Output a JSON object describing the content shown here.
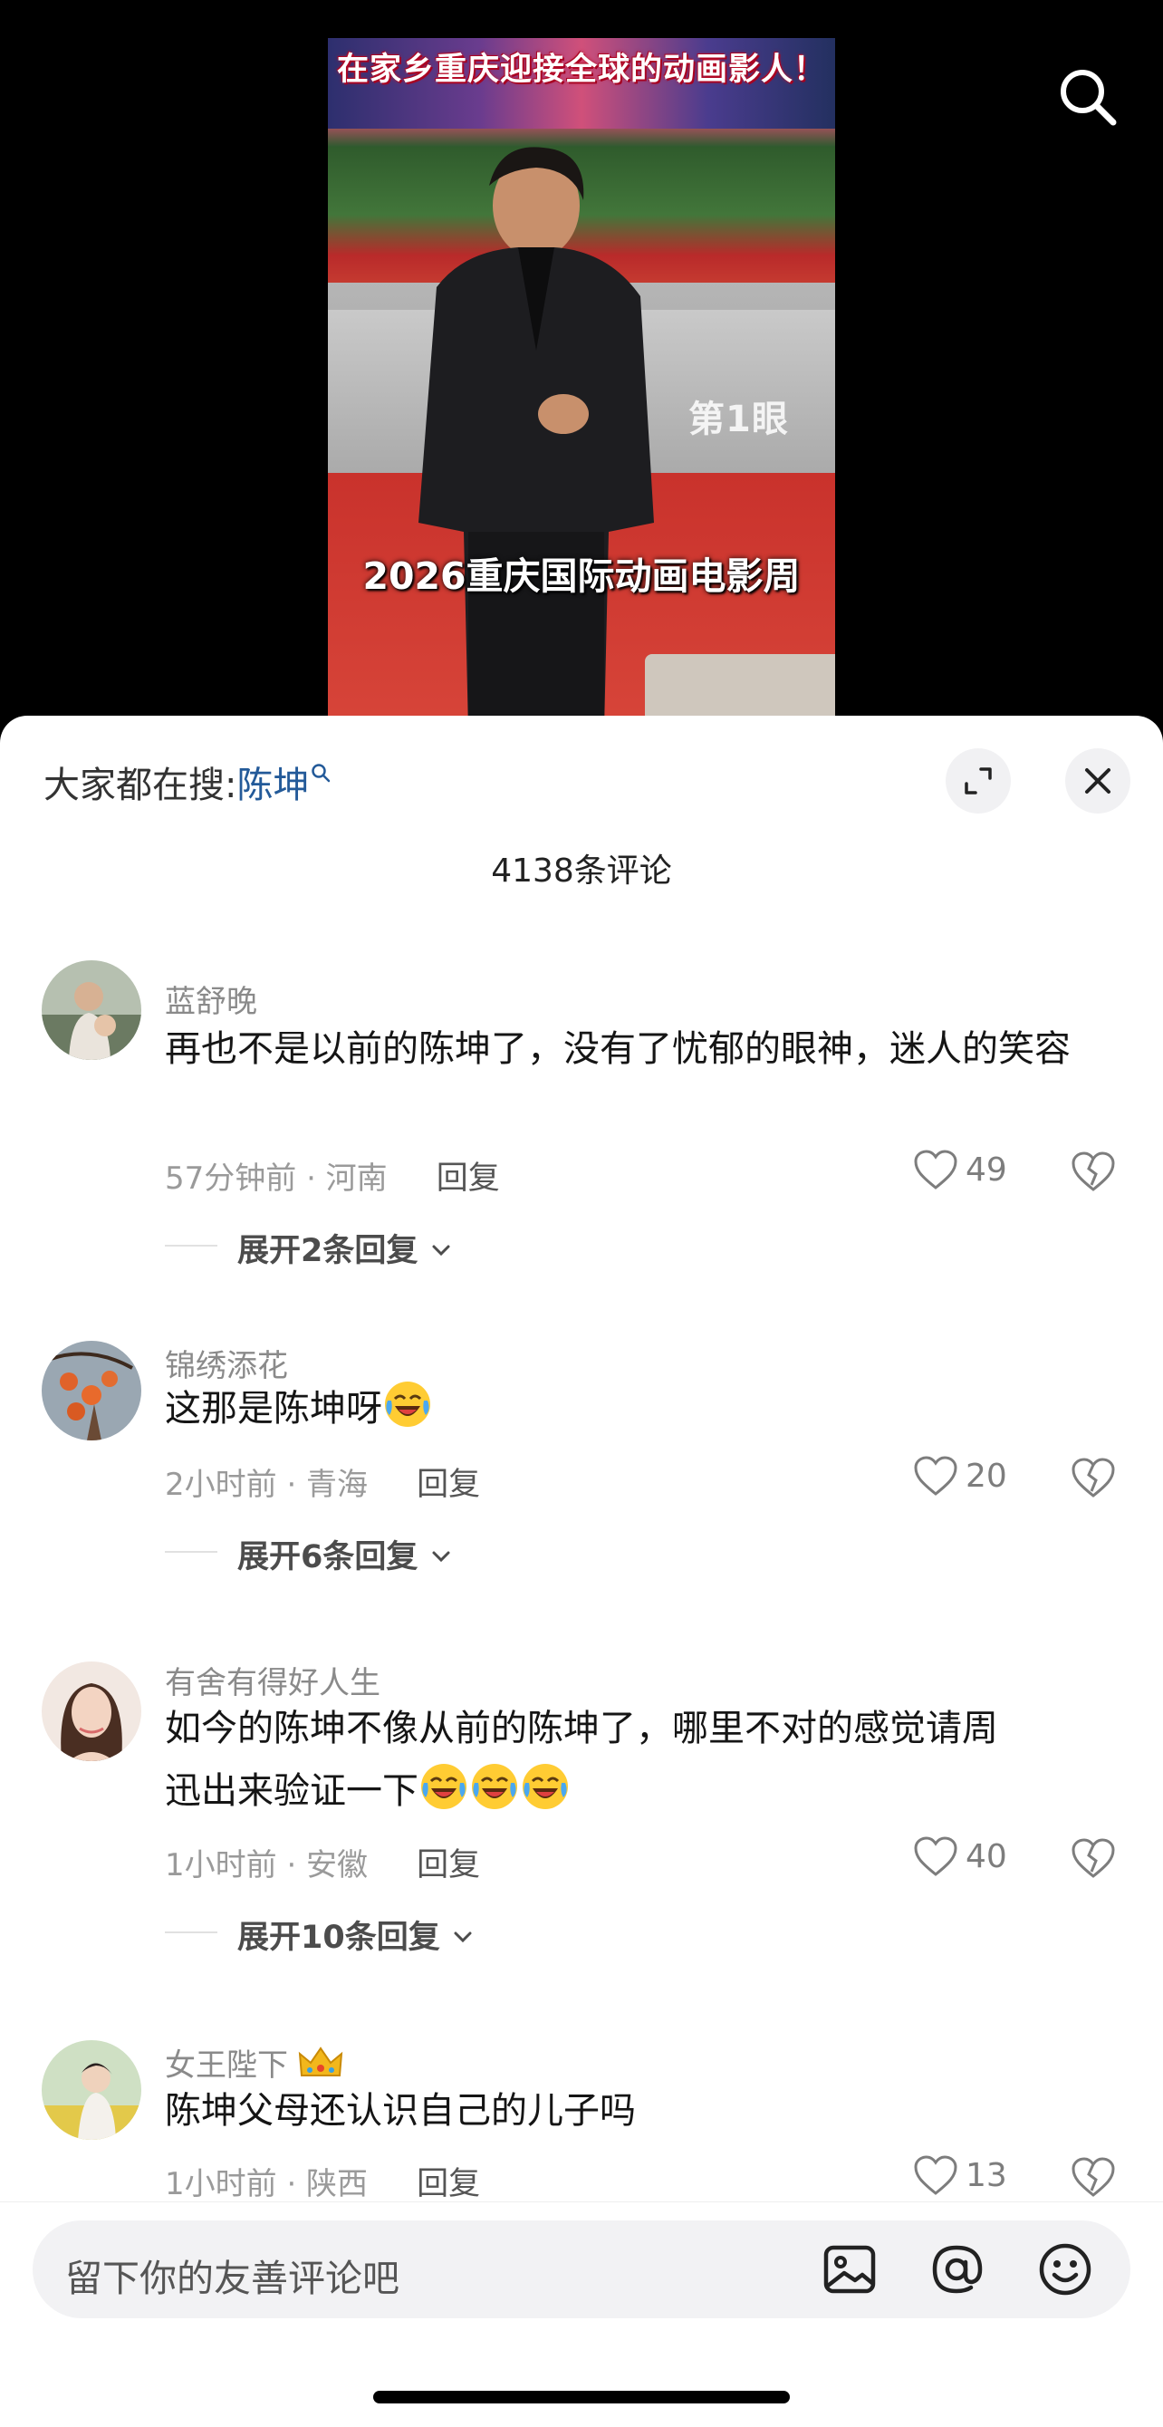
{
  "video": {
    "top_caption": "在家乡重庆迎接全球的动画影人！",
    "bottom_caption": "2026重庆国际动画电影周",
    "watermark": "第1眼"
  },
  "header": {
    "hot_search_prefix": "大家都在搜:",
    "hot_search_keyword": "陈坤",
    "comment_count_label": "4138条评论"
  },
  "comments": [
    {
      "username": "蓝舒晚",
      "text": "再也不是以前的陈坤了，没有了忧郁的眼神，迷人的笑容",
      "meta": "57分钟前 · 河南",
      "reply_label": "回复",
      "likes": "49",
      "expand_label": "展开2条回复"
    },
    {
      "username": "锦绣添花",
      "text": "这那是陈坤呀",
      "meta": "2小时前 · 青海",
      "reply_label": "回复",
      "likes": "20",
      "expand_label": "展开6条回复"
    },
    {
      "username": "有舍有得好人生",
      "text_line1": "如今的陈坤不像从前的陈坤了，哪里不对的感觉请周",
      "text_line2": "迅出来验证一下",
      "meta": "1小时前 · 安徽",
      "reply_label": "回复",
      "likes": "40",
      "expand_label": "展开10条回复"
    },
    {
      "username": "女王陛下",
      "text": "陈坤父母还认识自己的儿子吗",
      "meta": "1小时前 · 陕西",
      "reply_label": "回复",
      "likes": "13"
    }
  ],
  "input": {
    "placeholder": "留下你的友善评论吧"
  },
  "icons": {
    "search": "search-icon",
    "expand": "expand-icon",
    "close": "close-icon",
    "like": "heart-icon",
    "dislike": "broken-heart-icon",
    "image": "image-icon",
    "mention": "at-icon",
    "emoji": "smiley-icon",
    "crown": "crown-icon",
    "crying_emoji": "crying-laughing-emoji"
  },
  "colors": {
    "keyword": "#235a99",
    "meta_gray": "#9a9a9a",
    "sheet_bg": "#ffffff"
  }
}
